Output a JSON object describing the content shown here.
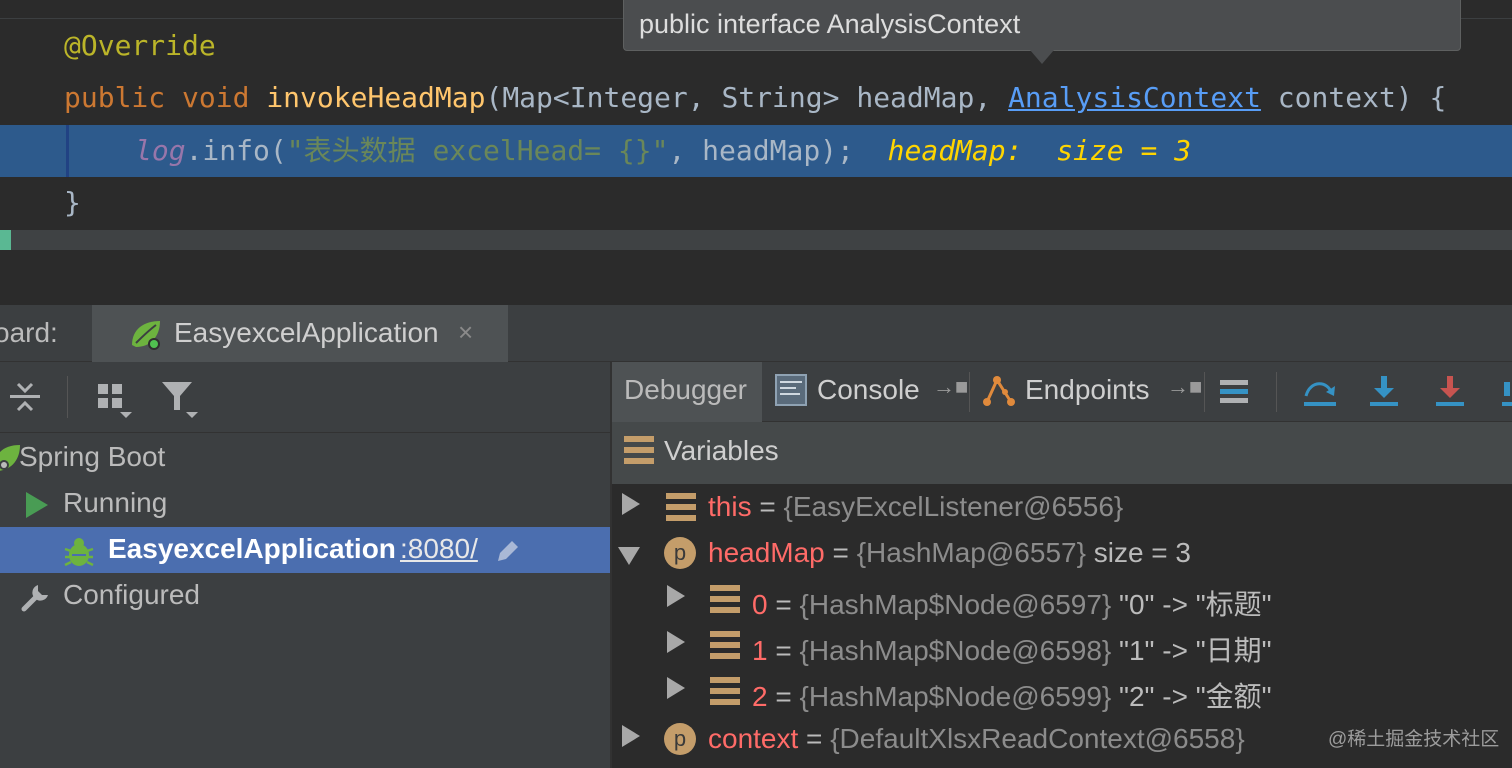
{
  "editor": {
    "annotation": "@Override",
    "signature": {
      "kw_public": "public",
      "kw_void": "void",
      "method": "invokeHeadMap",
      "params_1": "(Map<Integer, String> headMap, ",
      "type_link": "AnalysisContext",
      "params_2": " context) {"
    },
    "exec_line": {
      "field": "log",
      "call": ".info(",
      "string": "\"表头数据 excelHead= {}\"",
      "rest": ", headMap);",
      "inline_value": "headMap:  size = 3"
    },
    "closing": "}"
  },
  "tooltip": {
    "text": "public interface AnalysisContext"
  },
  "dashboard": {
    "label": "oard:",
    "tab_label": "EasyexcelApplication",
    "tab_close": "×"
  },
  "services_tree": {
    "root": "Spring Boot",
    "running": "Running",
    "app": "EasyexcelApplication",
    "app_port": ":8080/",
    "configured": "Configured"
  },
  "debugger": {
    "tabs": {
      "debugger": "Debugger",
      "console": "Console",
      "endpoints": "Endpoints",
      "pin": "→■"
    },
    "variables_label": "Variables",
    "variables": [
      {
        "name": "this",
        "eq": " = ",
        "ref": "{EasyExcelListener@6556}",
        "extra": ""
      },
      {
        "name": "headMap",
        "eq": " = ",
        "ref": "{HashMap@6557}",
        "extra": "  size = 3"
      },
      {
        "name": "0",
        "eq": " = ",
        "ref": "{HashMap$Node@6597}",
        "extra": " \"0\" -> \"标题\""
      },
      {
        "name": "1",
        "eq": " = ",
        "ref": "{HashMap$Node@6598}",
        "extra": " \"1\" -> \"日期\""
      },
      {
        "name": "2",
        "eq": " = ",
        "ref": "{HashMap$Node@6599}",
        "extra": " \"2\" -> \"金额\""
      },
      {
        "name": "context",
        "eq": " = ",
        "ref": "{DefaultXlsxReadContext@6558}",
        "extra": ""
      }
    ]
  },
  "watermark": "@稀土掘金技术社区",
  "colors": {
    "selection": "#4b6eaf",
    "exec_line": "#2d5a8c",
    "spring_green": "#6db33f"
  }
}
